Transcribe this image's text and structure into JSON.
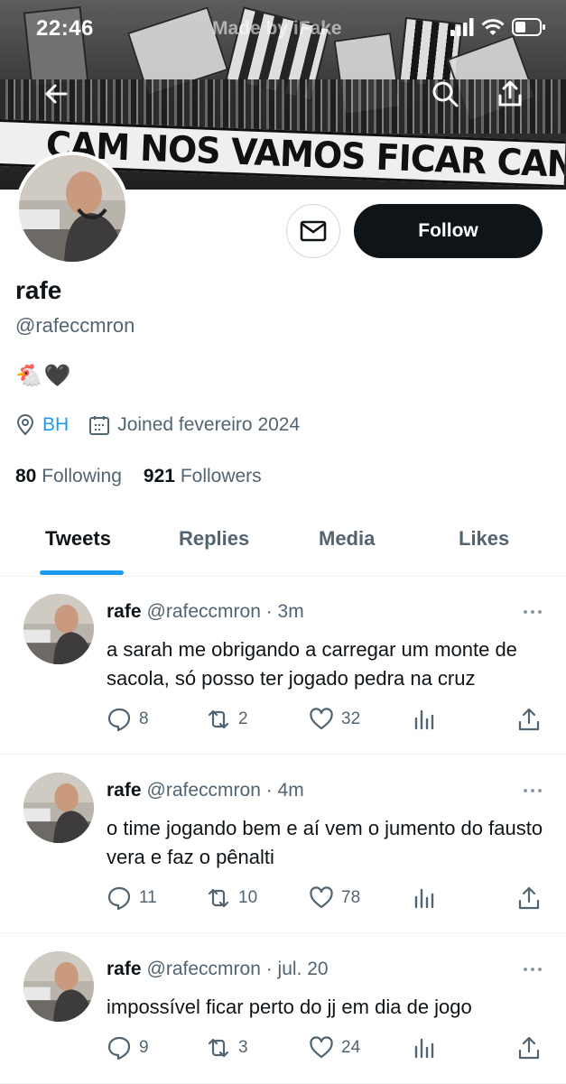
{
  "status_bar": {
    "time": "22:46",
    "watermark": "Made by iFake"
  },
  "banner": {
    "fan_banner_text": "CAM NOS VAMOS FICAR CANTAR"
  },
  "profile": {
    "display_name": "rafe",
    "handle": "@rafeccmron",
    "bio_emojis": [
      "🐔",
      "🖤"
    ],
    "location": "BH",
    "joined": "Joined fevereiro 2024",
    "following_count": "80",
    "following_label": "Following",
    "followers_count": "921",
    "followers_label": "Followers",
    "follow_label": "Follow"
  },
  "tabs": [
    {
      "label": "Tweets",
      "active": true
    },
    {
      "label": "Replies",
      "active": false
    },
    {
      "label": "Media",
      "active": false
    },
    {
      "label": "Likes",
      "active": false
    }
  ],
  "tweets": [
    {
      "name": "rafe",
      "handle": "@rafeccmron",
      "time": "· 3m",
      "text": "a sarah me obrigando a carregar um monte de sacola, só posso ter jogado pedra na cruz",
      "replies": "8",
      "retweets": "2",
      "likes": "32"
    },
    {
      "name": "rafe",
      "handle": "@rafeccmron",
      "time": "· 4m",
      "text": "o time jogando bem e aí vem o jumento do fausto vera e faz o pênalti",
      "replies": "11",
      "retweets": "10",
      "likes": "78"
    },
    {
      "name": "rafe",
      "handle": "@rafeccmron",
      "time": "· jul. 20",
      "text": "impossível ficar perto do jj em dia de jogo",
      "replies": "9",
      "retweets": "3",
      "likes": "24"
    }
  ],
  "icons": {
    "back": "back-arrow-icon",
    "search": "search-icon",
    "share": "share-icon",
    "mail": "envelope-icon",
    "location": "location-pin-icon",
    "calendar": "calendar-icon",
    "reply": "reply-icon",
    "retweet": "retweet-icon",
    "like": "heart-icon",
    "views": "analytics-icon"
  },
  "colors": {
    "accent": "#1d9bf0",
    "text": "#0f1419",
    "muted": "#536471",
    "follow_bg": "#0f1419"
  }
}
